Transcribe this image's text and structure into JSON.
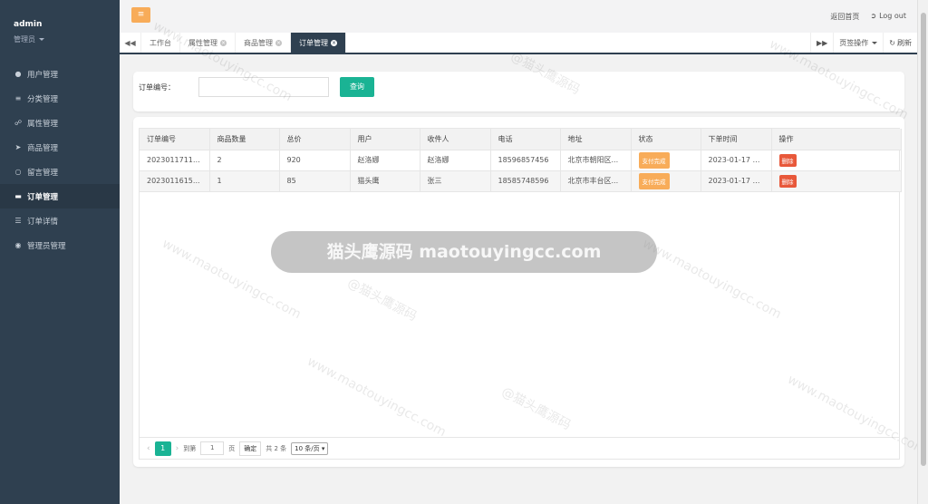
{
  "sidebar": {
    "user_name": "admin",
    "user_role": "管理员",
    "items": [
      {
        "label": "用户管理",
        "icon": "user-icon"
      },
      {
        "label": "分类管理",
        "icon": "category-icon"
      },
      {
        "label": "属性管理",
        "icon": "attribute-icon"
      },
      {
        "label": "商品管理",
        "icon": "product-icon"
      },
      {
        "label": "留言管理",
        "icon": "message-icon"
      },
      {
        "label": "订单管理",
        "icon": "order-icon",
        "active": true
      },
      {
        "label": "订单详情",
        "icon": "order-detail-icon"
      },
      {
        "label": "管理员管理",
        "icon": "admin-icon"
      }
    ]
  },
  "topbar": {
    "home_link": "返回首页",
    "logout": "Log out"
  },
  "tabs": {
    "items": [
      {
        "label": "工作台"
      },
      {
        "label": "属性管理"
      },
      {
        "label": "商品管理"
      },
      {
        "label": "订单管理",
        "active": true
      }
    ],
    "page_ops": "页签操作",
    "refresh": "刷新"
  },
  "search": {
    "label": "订单编号：",
    "value": "",
    "button": "查询"
  },
  "table": {
    "columns": [
      "订单编号",
      "商品数量",
      "总价",
      "用户",
      "收件人",
      "电话",
      "地址",
      "状态",
      "下单时间",
      "操作"
    ],
    "rows": [
      {
        "order_no": "20230117110...",
        "qty": "2",
        "total": "920",
        "user": "赵洛娜",
        "receiver": "赵洛娜",
        "phone": "18596857456",
        "address": "北京市朝阳区...",
        "status": "支付完成",
        "time": "2023-01-17 1...",
        "action": "删除"
      },
      {
        "order_no": "2023011615...",
        "qty": "1",
        "total": "85",
        "user": "猫头鹰",
        "receiver": "张三",
        "phone": "18585748596",
        "address": "北京市丰台区...",
        "status": "支付完成",
        "time": "2023-01-17 0...",
        "action": "删除"
      }
    ]
  },
  "pager": {
    "current": "1",
    "goto_label": "到第",
    "goto_value": "1",
    "page_unit": "页",
    "confirm": "确定",
    "total": "共 2 条",
    "page_size": "10 条/页"
  },
  "watermark": {
    "banner": "猫头鹰源码 maotouyingcc.com",
    "site": "www.maotouyingcc.com",
    "mark": "@猫头鹰源码"
  },
  "colors": {
    "sidebar_bg": "#2f4050",
    "accent": "#1ab394",
    "warning": "#f8ac59",
    "danger": "#e8583a"
  }
}
